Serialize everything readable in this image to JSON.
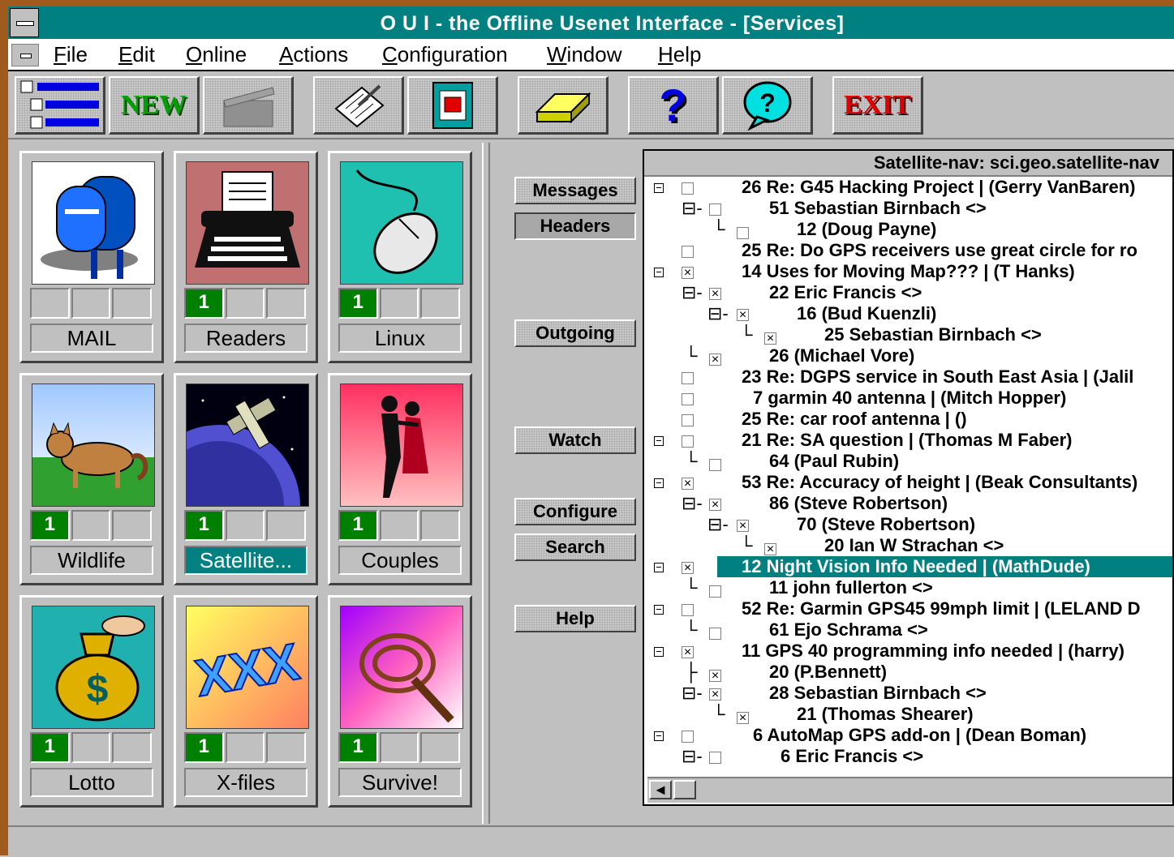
{
  "window": {
    "title": "O U I - the Offline Usenet Interface - [Services]"
  },
  "menu": [
    {
      "label": "File"
    },
    {
      "label": "Edit"
    },
    {
      "label": "Online"
    },
    {
      "label": "Actions"
    },
    {
      "label": "Configuration"
    },
    {
      "label": "Window"
    },
    {
      "label": "Help"
    }
  ],
  "toolbar": {
    "new_label": "NEW",
    "help_label": "?",
    "exit_label": "EXIT"
  },
  "services": [
    {
      "name": "MAIL",
      "count": ""
    },
    {
      "name": "Readers",
      "count": "1"
    },
    {
      "name": "Linux",
      "count": "1"
    },
    {
      "name": "Wildlife",
      "count": "1"
    },
    {
      "name": "Satellite...",
      "count": "1"
    },
    {
      "name": "Couples",
      "count": "1"
    },
    {
      "name": "Lotto",
      "count": "1"
    },
    {
      "name": "X-files",
      "count": "1"
    },
    {
      "name": "Survive!",
      "count": "1"
    }
  ],
  "side_buttons": {
    "messages": "Messages",
    "headers": "Headers",
    "outgoing": "Outgoing",
    "watch": "Watch",
    "configure": "Configure",
    "search": "Search",
    "help": "Help"
  },
  "thread_list": {
    "header": "Satellite-nav: sci.geo.satellite-nav",
    "rows": [
      {
        "text": "26 Re: G45 Hacking Project | (Gerry VanBaren)"
      },
      {
        "text": "51 Sebastian Birnbach <>"
      },
      {
        "text": "12 (Doug Payne)"
      },
      {
        "text": "25 Re: Do GPS receivers use great circle for ro"
      },
      {
        "text": "14 Uses for Moving Map??? | (T Hanks)"
      },
      {
        "text": "22 Eric Francis <>"
      },
      {
        "text": "16 (Bud Kuenzli)"
      },
      {
        "text": "25 Sebastian Birnbach <>"
      },
      {
        "text": "26 (Michael Vore)"
      },
      {
        "text": "23 Re: DGPS service in South East Asia | (Jalil"
      },
      {
        "text": "7 garmin 40 antenna | (Mitch Hopper)"
      },
      {
        "text": "25 Re: car roof antenna | ()"
      },
      {
        "text": "21 Re: SA question | (Thomas M Faber)"
      },
      {
        "text": "64 (Paul Rubin)"
      },
      {
        "text": "53 Re: Accuracy of height | (Beak Consultants)"
      },
      {
        "text": "86 (Steve Robertson)"
      },
      {
        "text": "70 (Steve Robertson)"
      },
      {
        "text": "20 Ian W Strachan <>"
      },
      {
        "text": "12 Night Vision Info Needed | (MathDude)"
      },
      {
        "text": "11 john fullerton <>"
      },
      {
        "text": "52 Re: Garmin GPS45 99mph limit | (LELAND D"
      },
      {
        "text": "61 Ejo Schrama <>"
      },
      {
        "text": "11 GPS 40 programming info needed | (harry)"
      },
      {
        "text": "20 (P.Bennett)"
      },
      {
        "text": "28 Sebastian Birnbach <>"
      },
      {
        "text": "21 (Thomas Shearer)"
      },
      {
        "text": "6 AutoMap GPS add-on | (Dean Boman)"
      },
      {
        "text": "6 Eric Francis <>"
      }
    ]
  },
  "colors": {
    "title_bar": "#008080",
    "selection": "#008080",
    "new_badge": "#008000",
    "frame": "#a05a1e"
  }
}
